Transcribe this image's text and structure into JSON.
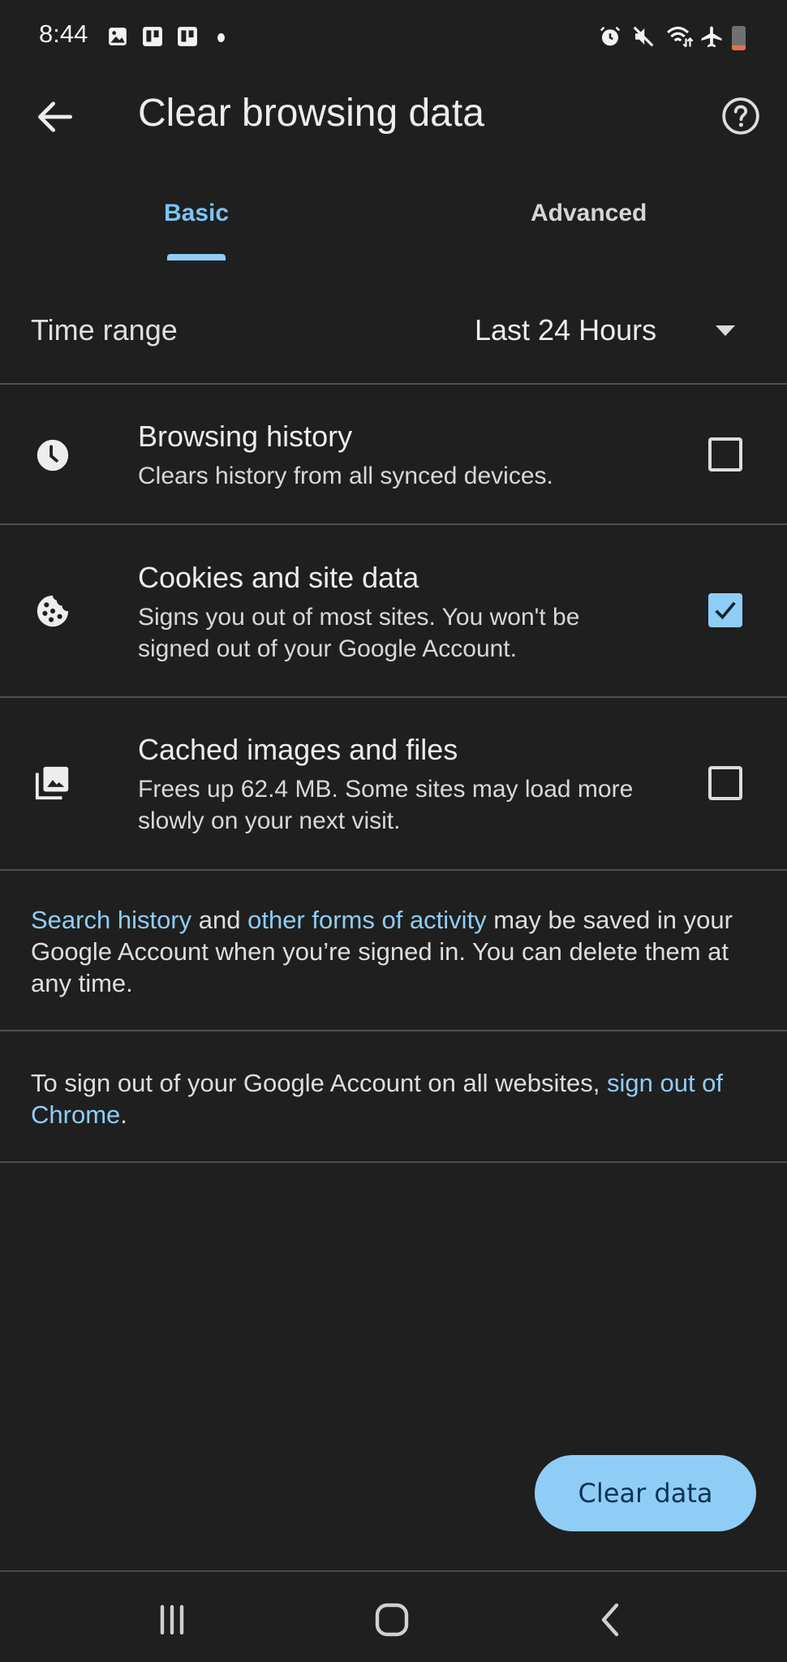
{
  "status_bar": {
    "time": "8:44",
    "left_icons": [
      "gallery-icon",
      "trello-icon",
      "trello-icon",
      "notification-dot-icon"
    ],
    "right_icons": [
      "alarm-icon",
      "mute-icon",
      "wifi-icon",
      "airplane-icon",
      "battery-low-icon"
    ]
  },
  "app_bar": {
    "title": "Clear browsing data",
    "back_icon": "arrow-back-icon",
    "help_icon": "help-icon"
  },
  "tabs": [
    {
      "label": "Basic",
      "selected": true
    },
    {
      "label": "Advanced",
      "selected": false
    }
  ],
  "time_range": {
    "label": "Time range",
    "value": "Last 24 Hours"
  },
  "options": [
    {
      "title": "Browsing history",
      "subtitle": "Clears history from all synced devices.",
      "icon": "clock-icon",
      "checked": false
    },
    {
      "title": "Cookies and site data",
      "subtitle": "Signs you out of most sites. You won't be signed out of your Google Account.",
      "icon": "cookie-icon",
      "checked": true
    },
    {
      "title": "Cached images and files",
      "subtitle": "Frees up 62.4 MB. Some sites may load more slowly on your next visit.",
      "icon": "image-icon",
      "checked": false
    }
  ],
  "notes": {
    "activity": {
      "link1": "Search history",
      "text1": " and ",
      "link2": "other forms of activity",
      "text2": " may be saved in your Google Account when you’re signed in. You can delete them at any time."
    },
    "signout": {
      "text1": "To sign out of your Google Account on all websites, ",
      "link": "sign out of Chrome",
      "text2": "."
    }
  },
  "clear_button": {
    "label": "Clear data"
  },
  "colors": {
    "accent": "#8fcdf7",
    "background": "#1f1f1f",
    "divider": "#4a4f54"
  },
  "nav_bar": [
    "recents-icon",
    "home-icon",
    "back-icon"
  ]
}
